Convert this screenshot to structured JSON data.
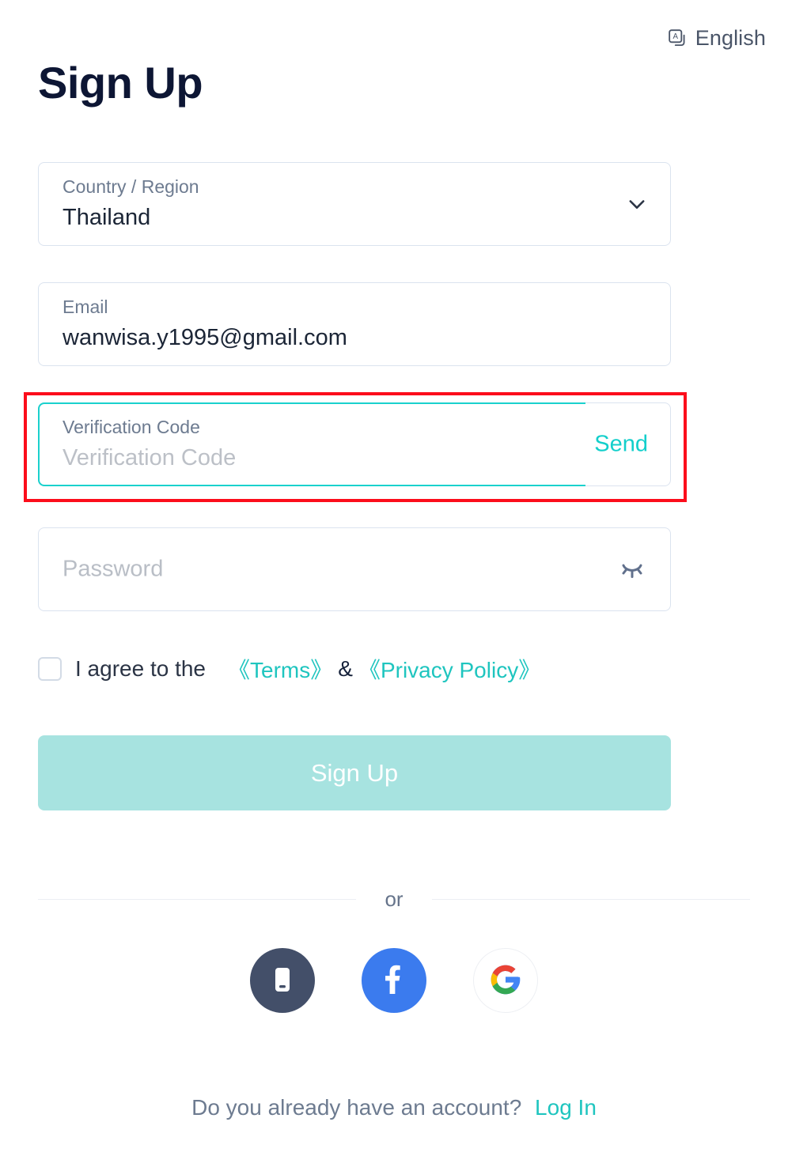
{
  "header": {
    "language_label": "English",
    "language_icon": "translate-icon"
  },
  "title": "Sign Up",
  "form": {
    "country": {
      "label": "Country / Region",
      "value": "Thailand",
      "dropdown_icon": "chevron-down-icon"
    },
    "email": {
      "label": "Email",
      "value": "wanwisa.y1995@gmail.com"
    },
    "verification": {
      "label": "Verification Code",
      "placeholder": "Verification Code",
      "value": "",
      "send_label": "Send",
      "focused": true
    },
    "password": {
      "placeholder": "Password",
      "value": "",
      "toggle_icon": "eye-closed-icon"
    }
  },
  "agreement": {
    "checked": false,
    "prefix": "I agree to the",
    "terms_label": "《Terms》",
    "separator": "&",
    "privacy_label": "《Privacy Policy》"
  },
  "submit_label": "Sign Up",
  "divider_label": "or",
  "social": [
    {
      "name": "phone",
      "icon": "mobile-phone-icon"
    },
    {
      "name": "facebook",
      "icon": "facebook-icon"
    },
    {
      "name": "google",
      "icon": "google-icon"
    }
  ],
  "footer": {
    "question": "Do you already have an account?",
    "login_label": "Log In"
  },
  "colors": {
    "accent": "#1fc5bf",
    "focus_border": "#1ad1cd",
    "submit_bg": "#a7e3e0",
    "title": "#0d1634",
    "annotation": "#fc0d1b",
    "facebook": "#3b7bee",
    "phone_bg": "#434f69"
  }
}
